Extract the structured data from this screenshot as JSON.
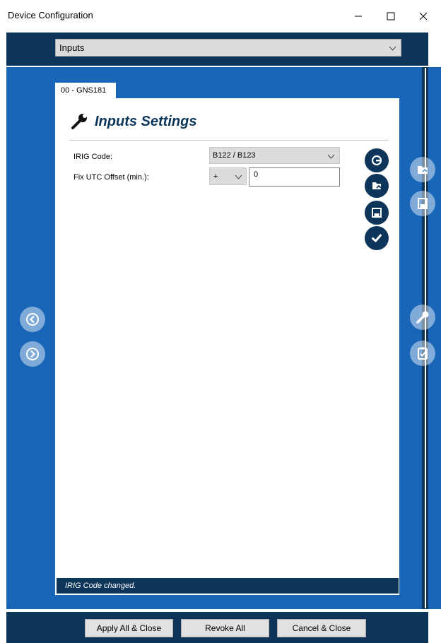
{
  "window": {
    "title": "Device Configuration",
    "buttons": {
      "minimize_icon": "minimize-icon",
      "maximize_icon": "maximize-icon",
      "close_icon": "close-icon"
    }
  },
  "header": {
    "dropdown_value": "Inputs"
  },
  "tab": {
    "label": "00 - GNS181"
  },
  "panel": {
    "heading": "Inputs Settings",
    "heading_icon": "wrench-icon",
    "fields": {
      "irig_code": {
        "label": "IRIG Code:",
        "value": "B122 / B123"
      },
      "utc_offset": {
        "label": "Fix UTC Offset (min.):",
        "sign": "+",
        "value": "0"
      }
    },
    "actions": [
      "revoke-icon",
      "load-icon",
      "save-icon",
      "apply-check-icon"
    ]
  },
  "status": {
    "message": "IRIG Code changed."
  },
  "footer": {
    "apply_all": "Apply All & Close",
    "revoke_all": "Revoke All",
    "cancel_close": "Cancel & Close"
  },
  "colors": {
    "navy": "#0c3559",
    "blue": "#1966b8",
    "panel_bg": "#ffffff",
    "control_gray": "#dcdcdc"
  }
}
